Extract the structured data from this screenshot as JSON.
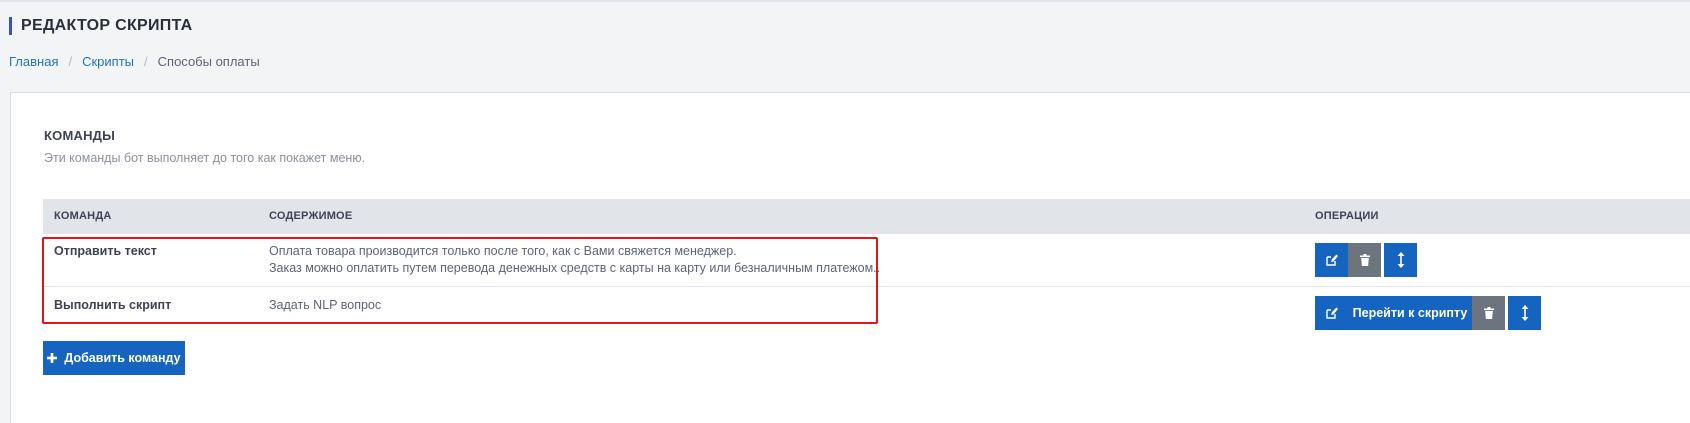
{
  "header": {
    "title": "РЕДАКТОР СКРИПТА"
  },
  "breadcrumb": {
    "items": [
      "Главная",
      "Скрипты"
    ],
    "current": "Способы оплаты"
  },
  "section": {
    "title": "КОМАНДЫ",
    "description": "Эти команды бот выполняет до того как покажет меню."
  },
  "table": {
    "headers": {
      "command": "КОМАНДА",
      "content": "СОДЕРЖИМОЕ",
      "operations": "ОПЕРАЦИИ"
    },
    "rows": [
      {
        "command": "Отправить текст",
        "content_lines": [
          "Оплата товара производится только после того, как с Вами свяжется менеджер.",
          "Заказ можно оплатить путем перевода денежных средств с карты на карту или безналичным платежом.."
        ]
      },
      {
        "command": "Выполнить скрипт",
        "content_lines": [
          "Задать NLP вопрос"
        ],
        "go_label": "Перейти к скрипту"
      }
    ]
  },
  "actions": {
    "add_label": "Добавить команду"
  },
  "icons": {
    "edit": "edit-icon",
    "delete": "trash-icon",
    "move": "move-vertical-icon",
    "add": "plus-icon"
  },
  "colors": {
    "accent": "#1565c0",
    "secondary": "#6c757d",
    "highlight": "#e3141d",
    "title_bar": "#3f51b5"
  }
}
